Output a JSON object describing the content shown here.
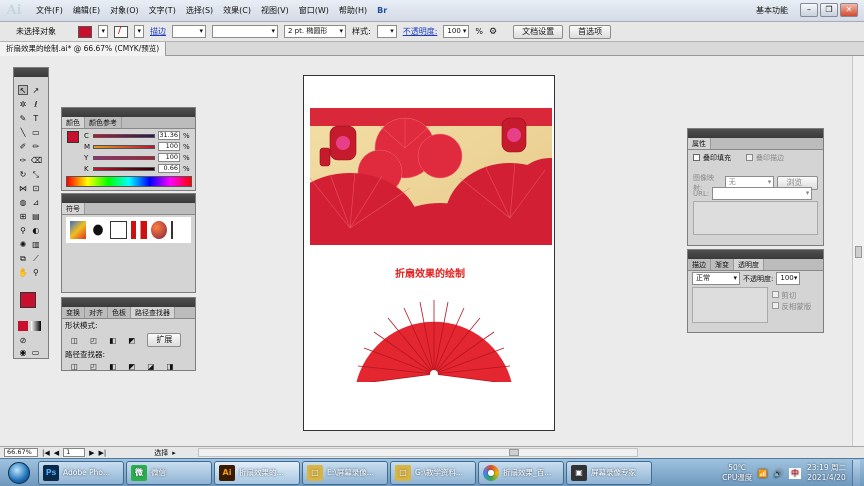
{
  "app": {
    "logo": "Ai",
    "menus": [
      "文件(F)",
      "编辑(E)",
      "对象(O)",
      "文字(T)",
      "选择(S)",
      "效果(C)",
      "视图(V)",
      "窗口(W)",
      "帮助(H)"
    ],
    "workspace": "基本功能"
  },
  "controlbar": {
    "selection": "未选择对象",
    "stroke_label": "描边",
    "stroke_size": "2 pt. 椭圆形",
    "style_label": "样式:",
    "opacity_label": "不透明度:",
    "opacity_value": "100",
    "opacity_unit": "%",
    "doc_setup": "文档设置",
    "prefs": "首选项",
    "fill_color": "#c8102e"
  },
  "document": {
    "tab_title": "折扇效果的绘制.ai* @ 66.67% (CMYK/预览)",
    "art_title": "折扇效果的绘制"
  },
  "color_panel": {
    "tabs": [
      "颜色",
      "颜色参考"
    ],
    "channels": [
      {
        "label": "C",
        "value": "31.36"
      },
      {
        "label": "M",
        "value": "100"
      },
      {
        "label": "Y",
        "value": "100"
      },
      {
        "label": "K",
        "value": "0.66"
      }
    ],
    "unit": "%"
  },
  "symbol_panel": {
    "tab": "符号"
  },
  "pathfinder_panel": {
    "tabs": [
      "变换",
      "对齐",
      "色板",
      "路径查找器"
    ],
    "shape_modes": "形状模式:",
    "expand": "扩展",
    "pathfinders": "路径查找器:"
  },
  "attributes_panel": {
    "tab": "属性",
    "overprint_fill": "叠印填充",
    "overprint_stroke": "叠印描边",
    "image_map": "图像映射:",
    "none": "无",
    "browser": "浏览器",
    "url": "URL:"
  },
  "transparency_panel": {
    "tabs": [
      "描边",
      "渐变",
      "透明度"
    ],
    "blend_mode": "正常",
    "opacity_label": "不透明度:",
    "opacity_value": "100",
    "clip": "剪切",
    "invert_mask": "反相蒙版"
  },
  "statusbar": {
    "zoom": "66.67%",
    "page": "1",
    "tool": "选择"
  },
  "taskbar": {
    "tasks": [
      {
        "label": "Adobe Pho...",
        "icon": "Ps",
        "color": "#0a2a4a"
      },
      {
        "label": "微信",
        "icon": "微",
        "color": "#2aae4e"
      },
      {
        "label": "折扇效果的...",
        "icon": "Ai",
        "color": "#3a1c00"
      },
      {
        "label": "E:\\屏幕录像...",
        "icon": "□",
        "color": "#d8b443"
      },
      {
        "label": "G:\\教学资料...",
        "icon": "□",
        "color": "#d8b443"
      },
      {
        "label": "折扇效果_百...",
        "icon": "●",
        "color": "#e04c2c"
      },
      {
        "label": "屏幕录像专家",
        "icon": "▣",
        "color": "#333333"
      }
    ],
    "weather": "50℃",
    "cpu": "CPU温度",
    "time": "23:19 周二",
    "date": "2021/4/20"
  }
}
